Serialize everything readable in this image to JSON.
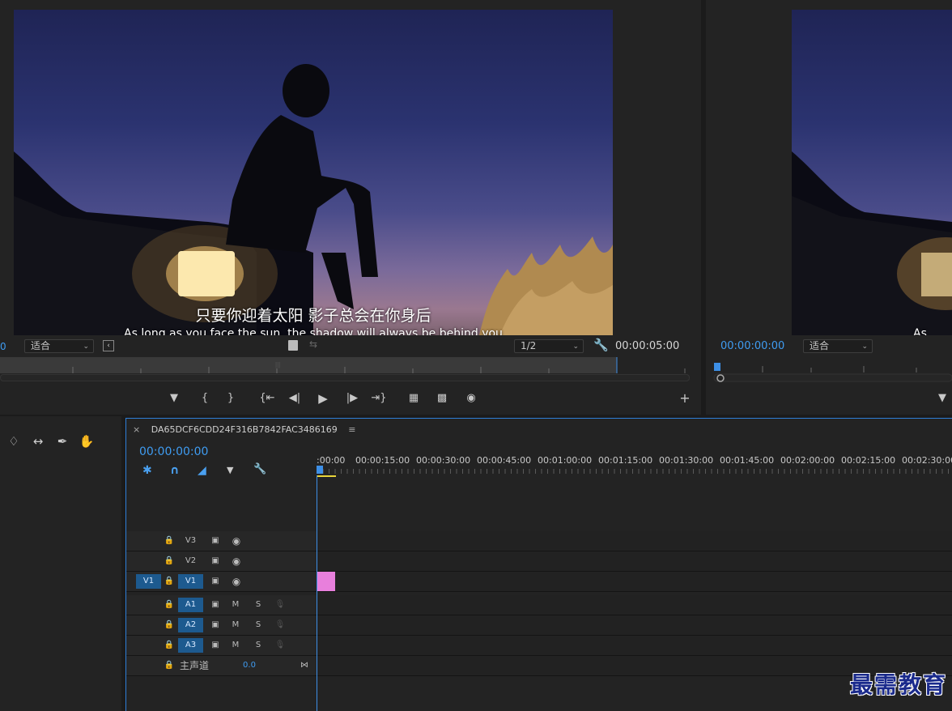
{
  "source_monitor": {
    "subtitle_zh": "只要你迎着太阳 影子总会在你身后",
    "subtitle_en": "As long as you face the sun, the shadow will always be behind you",
    "zoom_value": "适合",
    "resolution_value": "1/2",
    "duration": "00:00:05:00",
    "timecode_left": "0"
  },
  "program_monitor": {
    "timecode": "00:00:00:00",
    "zoom_value": "适合",
    "subtitle_fragment": "As long"
  },
  "timeline": {
    "sequence_name": "DA65DCF6CDD24F316B7842FAC3486169",
    "playhead_time": "00:00:00:00",
    "ruler_labels": [
      ":00:00",
      "00:00:15:00",
      "00:00:30:00",
      "00:00:45:00",
      "00:01:00:00",
      "00:01:15:00",
      "00:01:30:00",
      "00:01:45:00",
      "00:02:00:00",
      "00:02:15:00",
      "00:02:30:00"
    ],
    "video_tracks": [
      {
        "name": "V3",
        "source": ""
      },
      {
        "name": "V2",
        "source": ""
      },
      {
        "name": "V1",
        "source": "V1"
      }
    ],
    "audio_tracks": [
      {
        "name": "A1",
        "m": "M",
        "s": "S"
      },
      {
        "name": "A2",
        "m": "M",
        "s": "S"
      },
      {
        "name": "A3",
        "m": "M",
        "s": "S"
      }
    ],
    "master": {
      "label": "主声道",
      "value": "0.0"
    },
    "clip_color": "#e87fdc"
  },
  "watermark": "最需教育",
  "icons": {
    "close": "×",
    "menu": "≡"
  }
}
